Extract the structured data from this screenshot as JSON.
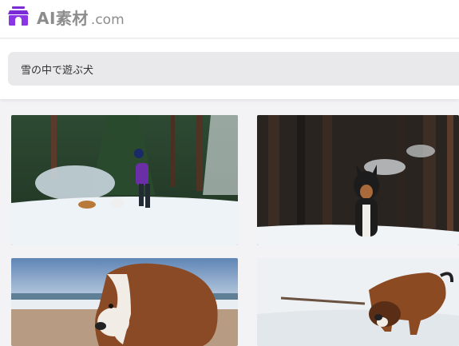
{
  "header": {
    "logo_icon": "storefront-icon",
    "logo_main": "AI素材",
    "logo_suffix": ".com",
    "brand_color": "#7a2bd6"
  },
  "search": {
    "value": "雪の中で遊ぶ犬"
  },
  "results": {
    "items": [
      {
        "name": "result-image-1"
      },
      {
        "name": "result-image-2"
      },
      {
        "name": "result-image-3"
      },
      {
        "name": "result-image-4"
      }
    ]
  }
}
